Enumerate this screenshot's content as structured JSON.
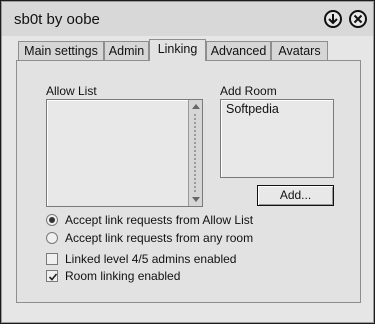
{
  "window": {
    "title": "sb0t by oobe"
  },
  "tabs": [
    {
      "label": "Main settings",
      "active": false
    },
    {
      "label": "Admin",
      "active": false
    },
    {
      "label": "Linking",
      "active": true
    },
    {
      "label": "Advanced",
      "active": false
    },
    {
      "label": "Avatars",
      "active": false
    }
  ],
  "linking": {
    "allow_list_label": "Allow List",
    "allow_list_items": [],
    "add_room_label": "Add Room",
    "add_room_value": "Softpedia",
    "add_button": "Add...",
    "radio_allow_list": "Accept link requests from Allow List",
    "radio_any_room": "Accept link requests from any room",
    "radio_selected": "allow_list",
    "check_admins": "Linked level 4/5 admins enabled",
    "check_admins_checked": false,
    "check_room_linking": "Room linking enabled",
    "check_room_linking_checked": true
  }
}
